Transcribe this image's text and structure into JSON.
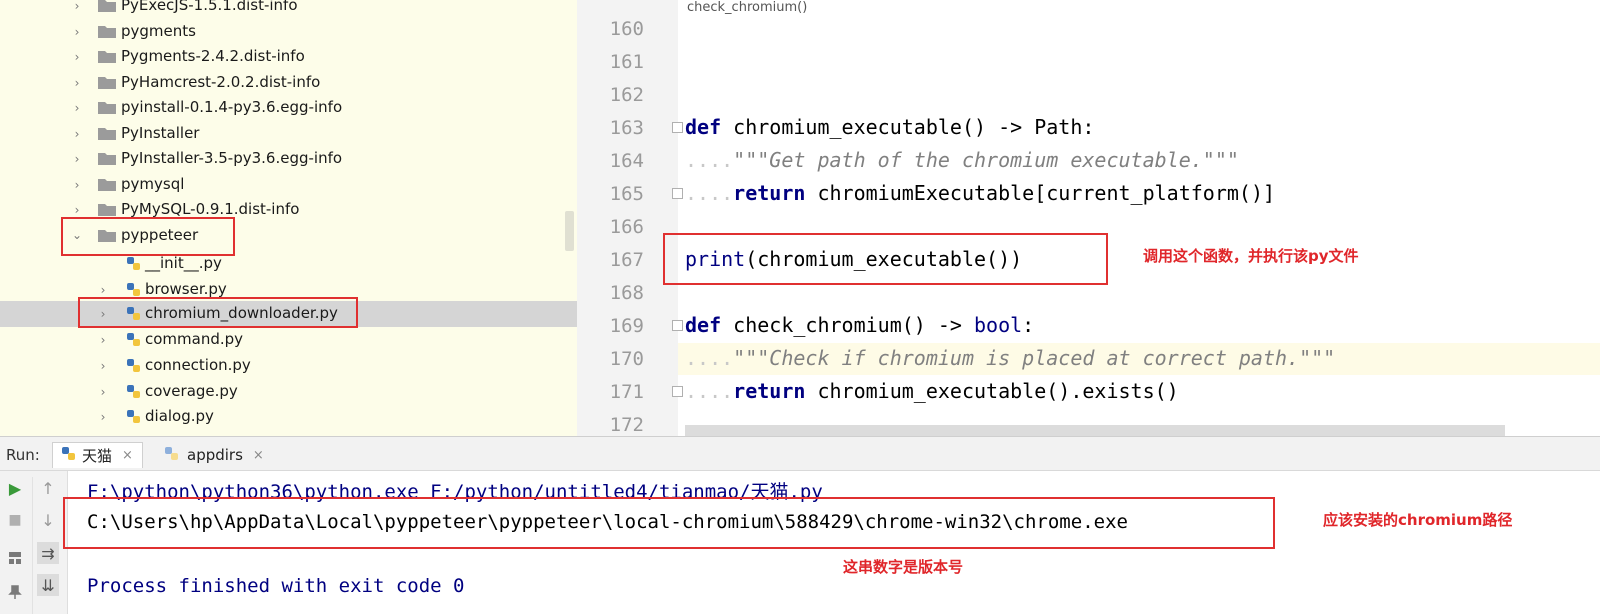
{
  "project_tree": {
    "items": [
      {
        "label": "PyExecJS-1.5.1.dist-info",
        "type": "folder",
        "expandable": true
      },
      {
        "label": "pygments",
        "type": "folder",
        "expandable": true
      },
      {
        "label": "Pygments-2.4.2.dist-info",
        "type": "folder",
        "expandable": true
      },
      {
        "label": "PyHamcrest-2.0.2.dist-info",
        "type": "folder",
        "expandable": true
      },
      {
        "label": "pyinstall-0.1.4-py3.6.egg-info",
        "type": "folder",
        "expandable": true
      },
      {
        "label": "PyInstaller",
        "type": "folder",
        "expandable": true
      },
      {
        "label": "PyInstaller-3.5-py3.6.egg-info",
        "type": "folder",
        "expandable": true
      },
      {
        "label": "pymysql",
        "type": "folder",
        "expandable": true
      },
      {
        "label": "PyMySQL-0.9.1.dist-info",
        "type": "folder",
        "expandable": true
      },
      {
        "label": "pyppeteer",
        "type": "folder",
        "expanded": true
      },
      {
        "label": "__init__.py",
        "type": "file"
      },
      {
        "label": "browser.py",
        "type": "file",
        "expandable": true
      },
      {
        "label": "chromium_downloader.py",
        "type": "file",
        "expandable": true,
        "selected": true
      },
      {
        "label": "command.py",
        "type": "file",
        "expandable": true
      },
      {
        "label": "connection.py",
        "type": "file",
        "expandable": true
      },
      {
        "label": "coverage.py",
        "type": "file",
        "expandable": true
      },
      {
        "label": "dialog.py",
        "type": "file",
        "expandable": true
      }
    ]
  },
  "editor": {
    "breadcrumb": "check_chromium()",
    "line_numbers": [
      "160",
      "161",
      "162",
      "163",
      "164",
      "165",
      "166",
      "167",
      "168",
      "169",
      "170",
      "171",
      "172"
    ],
    "code": {
      "l163_kw": "def",
      "l163_rest": " chromium_executable() -> Path:",
      "l164_ws": "....",
      "l164_doc": "\"\"\"Get path of the chromium executable.\"\"\"",
      "l165_ws": "....",
      "l165_kw": "return",
      "l165_rest": " chromiumExecutable[current_platform()]",
      "l167_bi": "print",
      "l167_rest": "(chromium_executable())",
      "l169_kw": "def",
      "l169_rest": " check_chromium() -> ",
      "l169_type": "bool",
      "l169_end": ":",
      "l170_ws": "....",
      "l170_doc": "\"\"\"Check if chromium is placed at correct path.\"\"\"",
      "l171_ws": "....",
      "l171_kw": "return",
      "l171_rest": " chromium_executable().exists()"
    }
  },
  "run_panel": {
    "label": "Run:",
    "tabs": [
      {
        "label": "天猫",
        "active": true
      },
      {
        "label": "appdirs",
        "active": false
      }
    ],
    "close_glyph": "×",
    "console": {
      "command": "F:\\python\\python36\\python.exe F:/python/untitled4/tianmao/天猫.py",
      "output": "C:\\Users\\hp\\AppData\\Local\\pyppeteer\\pyppeteer\\local-chromium\\588429\\chrome-win32\\chrome.exe",
      "finished": "Process finished with exit code 0"
    }
  },
  "annotations": {
    "call_note": "调用这个函数，并执行该py文件",
    "path_note": "应该安装的chromium路径",
    "version_note": "这串数字是版本号"
  },
  "colors": {
    "tree_bg": "#fdfde9",
    "annotation_red": "#e0262a",
    "keyword_navy": "#000080",
    "console_blue": "#000080"
  }
}
